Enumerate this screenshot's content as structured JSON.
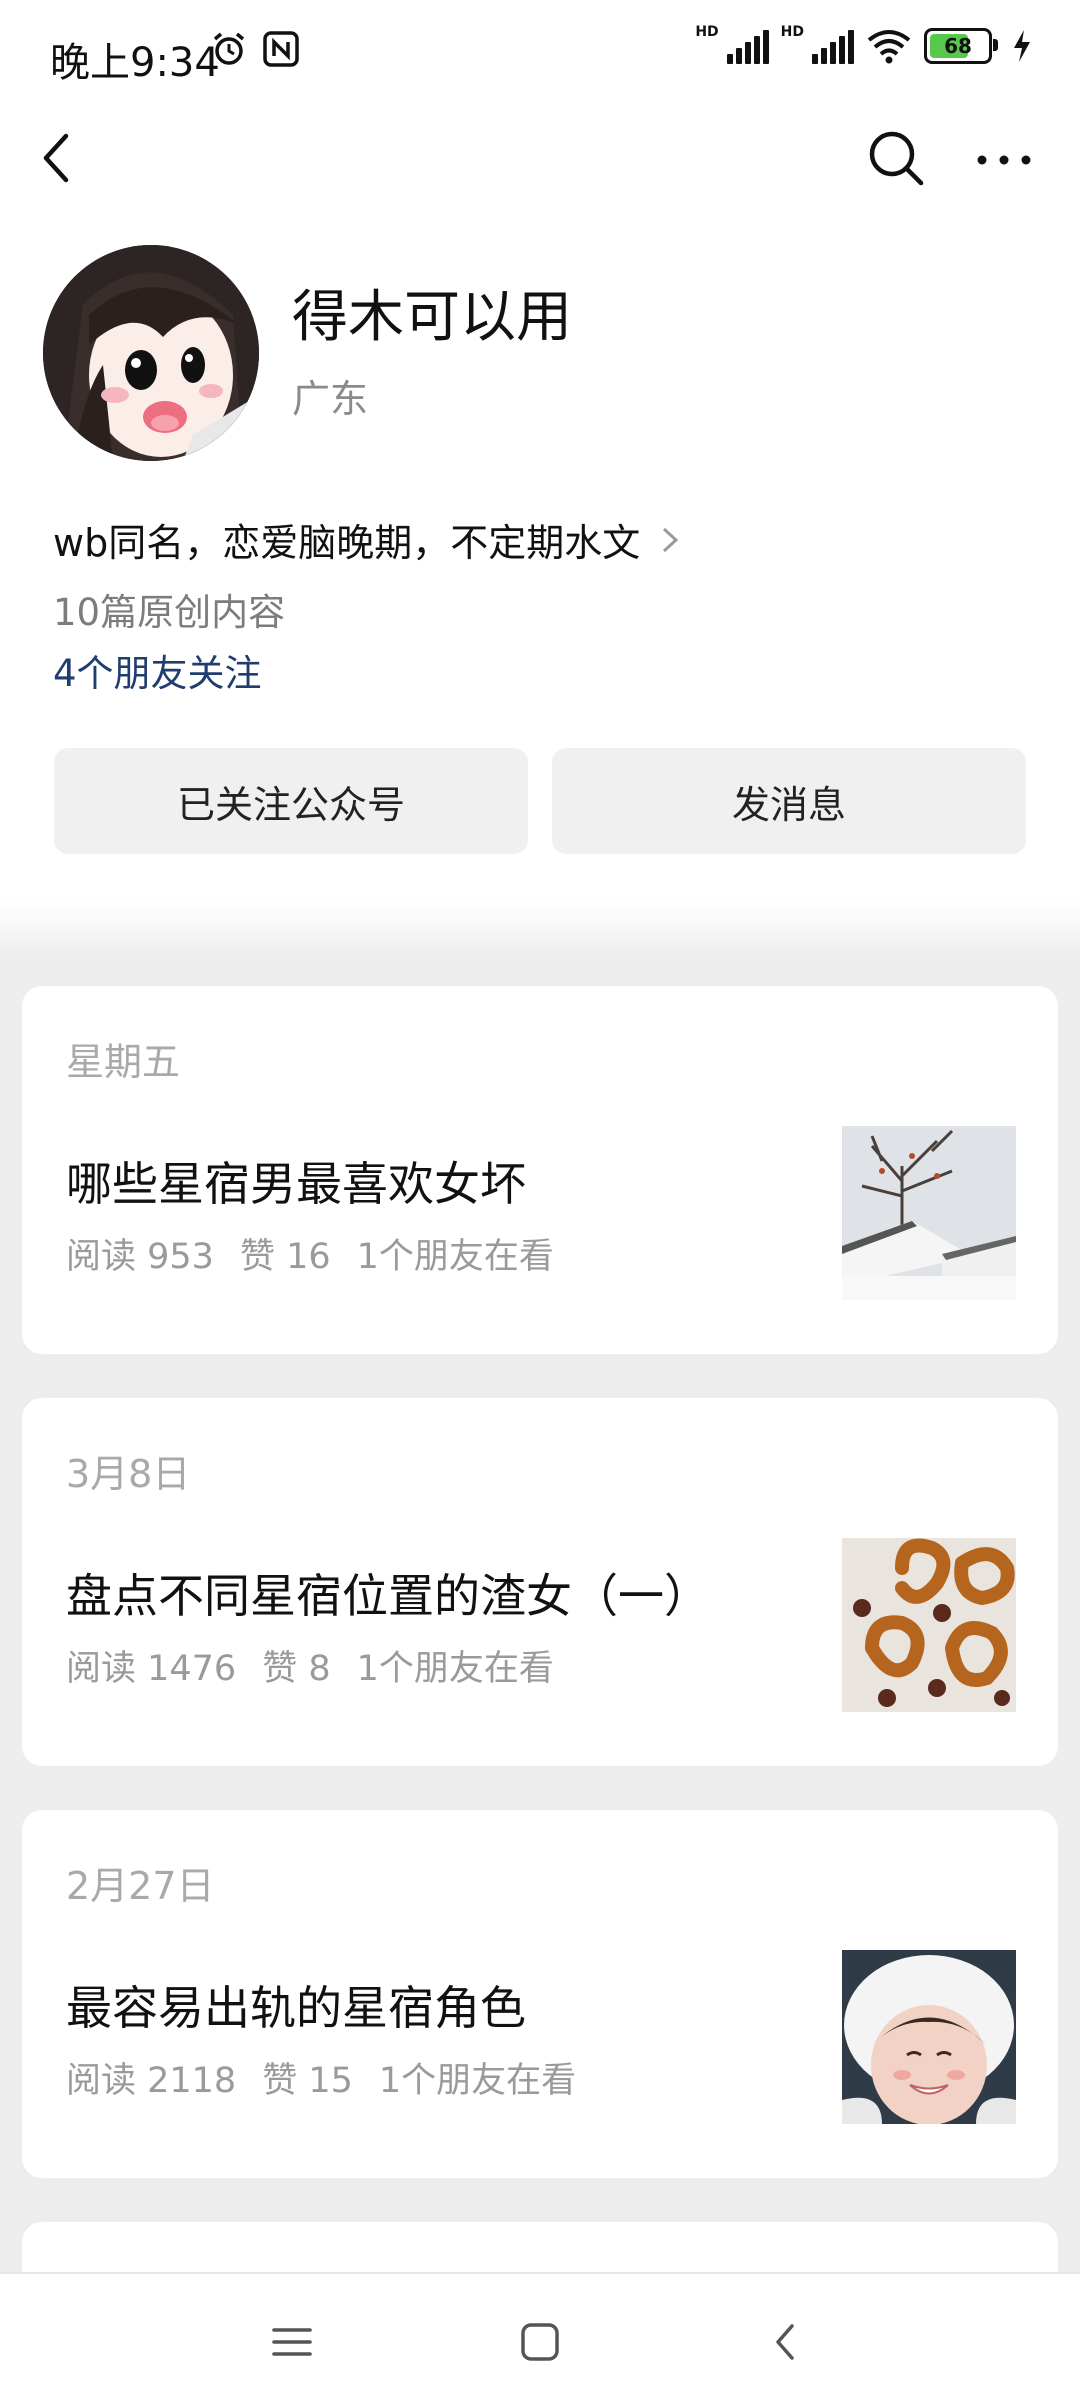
{
  "status_bar": {
    "time": "晚上9:34",
    "hd_label": "HD",
    "battery_level": "68",
    "icons": [
      "alarm-icon",
      "nfc-icon",
      "signal-icon",
      "signal-icon",
      "wifi-icon",
      "battery-icon",
      "charging-icon"
    ]
  },
  "nav": {
    "icons": [
      "back-icon",
      "search-icon",
      "more-icon"
    ]
  },
  "profile": {
    "name": "得木可以用",
    "region": "广东",
    "bio": "wb同名，恋爱脑晚期，不定期水文",
    "original_count": "10篇原创内容",
    "friends_following": "4个朋友关注"
  },
  "actions": {
    "follow_label": "已关注公众号",
    "message_label": "发消息"
  },
  "articles": [
    {
      "date": "星期五",
      "title": "哪些星宿男最喜欢女坏",
      "reads": "阅读 953",
      "likes": "赞 16",
      "friends": "1个朋友在看"
    },
    {
      "date": "3月8日",
      "title": "盘点不同星宿位置的渣女（一）",
      "reads": "阅读 1476",
      "likes": "赞 8",
      "friends": "1个朋友在看"
    },
    {
      "date": "2月27日",
      "title": "最容易出轨的星宿角色",
      "reads": "阅读 2118",
      "likes": "赞 15",
      "friends": "1个朋友在看"
    }
  ],
  "system_nav": {
    "icons": [
      "menu-icon",
      "home-icon",
      "back-icon"
    ]
  },
  "colors": {
    "link": "#1f3e6f",
    "background": "#ededed",
    "card": "#ffffff",
    "button": "#f0f0f0"
  }
}
